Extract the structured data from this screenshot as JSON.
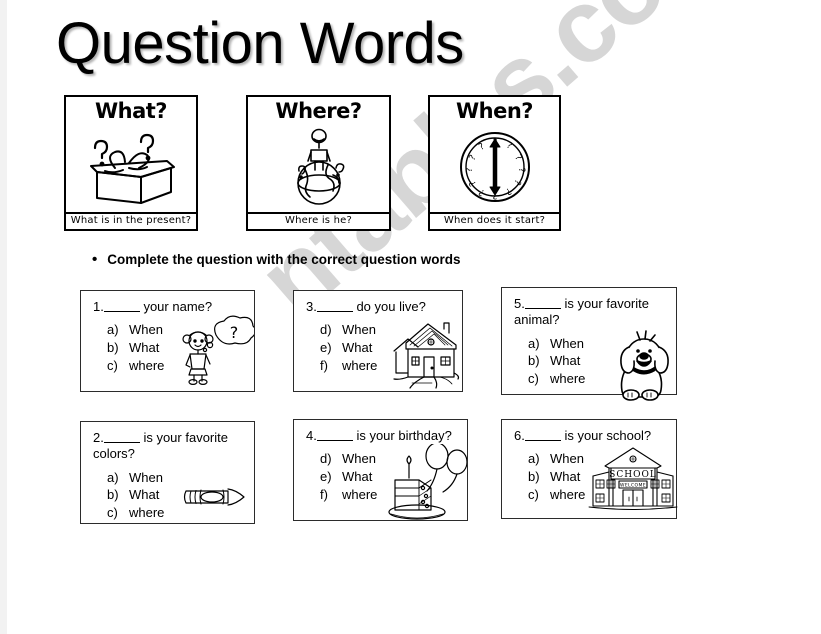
{
  "page": {
    "title": "Question Words",
    "watermark": "ntables.com"
  },
  "flashcards": [
    {
      "word": "What?",
      "caption": "What is in the present?",
      "art": "gift-box-with-question-marks"
    },
    {
      "word": "Where?",
      "caption": "Where is he?",
      "art": "person-standing-on-globe"
    },
    {
      "word": "When?",
      "caption": "When does it start?",
      "art": "clock-with-question-marks"
    }
  ],
  "instruction": {
    "bullet": "•",
    "text": "Complete the question with the correct question words"
  },
  "questions": [
    {
      "number": "1.",
      "stem_before": "",
      "stem_after": " your name?",
      "options": [
        {
          "key": "a)",
          "label": "When"
        },
        {
          "key": "b)",
          "label": "What"
        },
        {
          "key": "c)",
          "label": "where"
        }
      ],
      "art": "girl-with-thought-bubble"
    },
    {
      "number": "2.",
      "stem_before": "",
      "stem_after": " is your favorite colors?",
      "options": [
        {
          "key": "a)",
          "label": "When"
        },
        {
          "key": "b)",
          "label": "What"
        },
        {
          "key": "c)",
          "label": "where"
        }
      ],
      "art": "crayon"
    },
    {
      "number": "3.",
      "stem_before": "",
      "stem_after": " do you live?",
      "options": [
        {
          "key": "d)",
          "label": "When"
        },
        {
          "key": "e)",
          "label": "What"
        },
        {
          "key": "f)",
          "label": "where"
        }
      ],
      "art": "house"
    },
    {
      "number": "4.",
      "stem_before": "",
      "stem_after": " is your birthday?",
      "options": [
        {
          "key": "d)",
          "label": "When"
        },
        {
          "key": "e)",
          "label": "What"
        },
        {
          "key": "f)",
          "label": "where"
        }
      ],
      "art": "birthday-cake-with-balloons"
    },
    {
      "number": "5.",
      "stem_before": "",
      "stem_after": " is your favorite animal?",
      "options": [
        {
          "key": "a)",
          "label": "When"
        },
        {
          "key": "b)",
          "label": "What"
        },
        {
          "key": "c)",
          "label": "where"
        }
      ],
      "art": "dog"
    },
    {
      "number": "6.",
      "stem_before": "",
      "stem_after": " is your school?",
      "options": [
        {
          "key": "a)",
          "label": "When"
        },
        {
          "key": "b)",
          "label": "What"
        },
        {
          "key": "c)",
          "label": "where"
        }
      ],
      "art": "school-building",
      "art_text": {
        "sign": "SCHOOL",
        "banner": "WELCOME"
      }
    }
  ]
}
